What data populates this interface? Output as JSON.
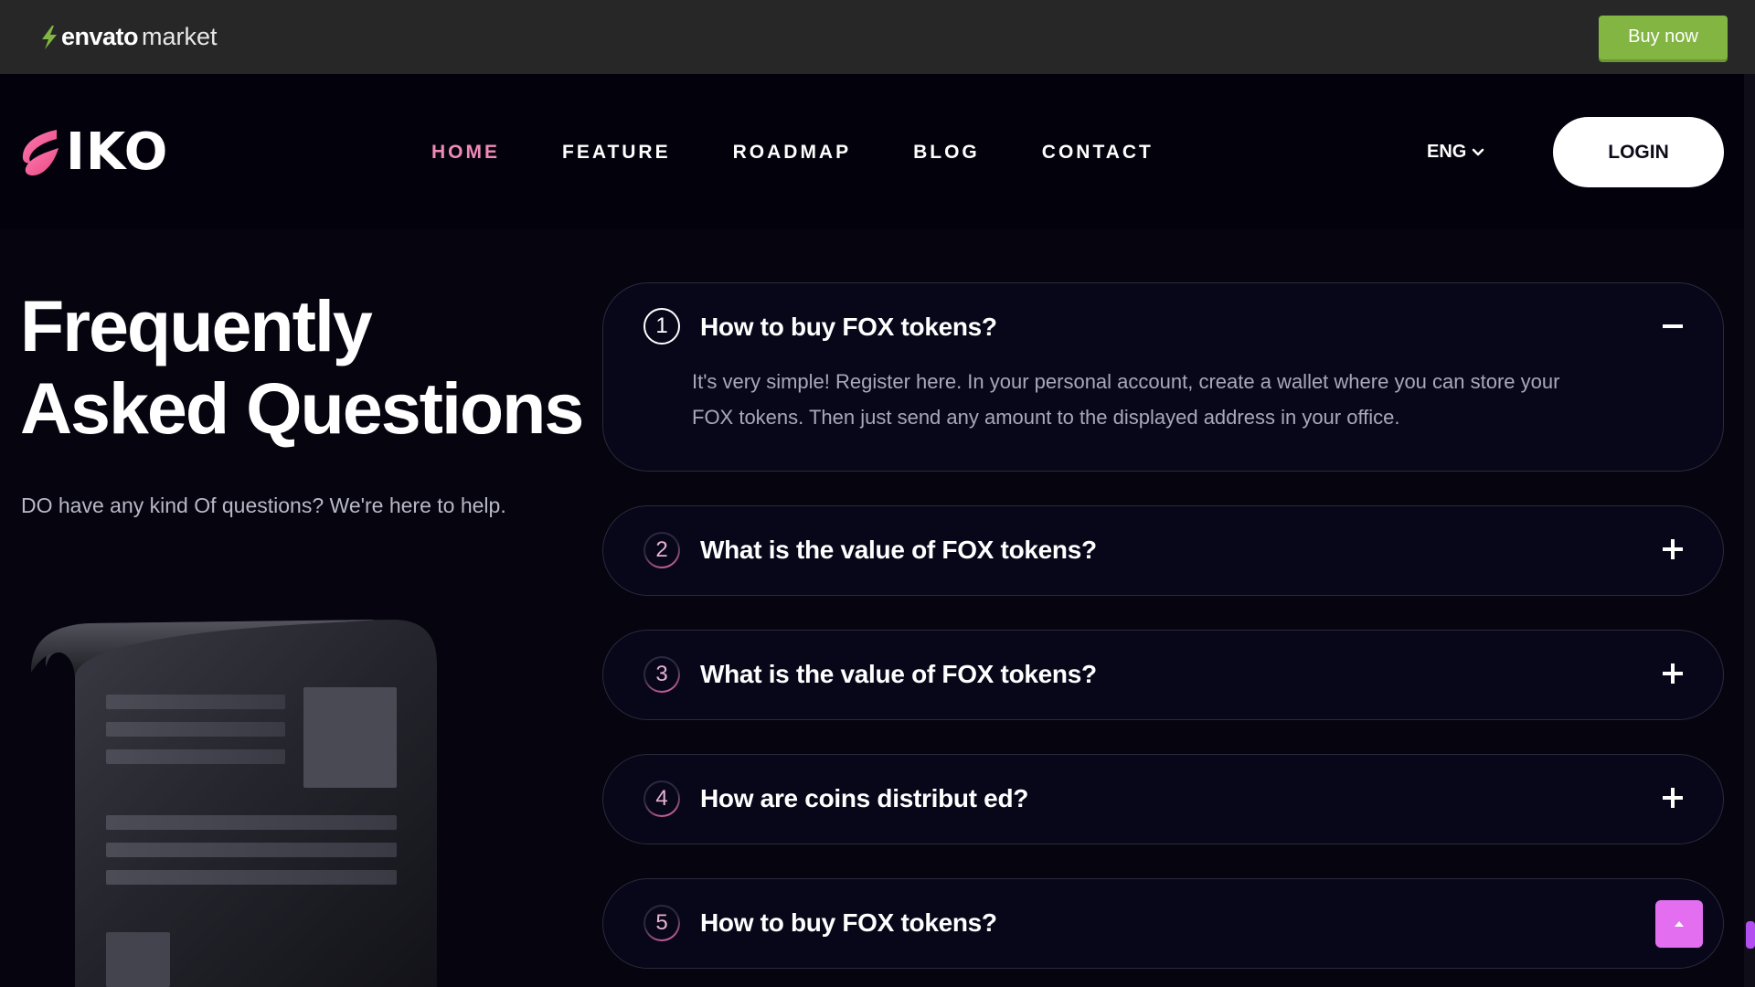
{
  "envato": {
    "brand": "envato",
    "market": "market",
    "buy_label": "Buy now",
    "accent": "#82b541"
  },
  "header": {
    "logo_text": "IKO",
    "nav": [
      {
        "label": "HOME",
        "active": true
      },
      {
        "label": "FEATURE",
        "active": false
      },
      {
        "label": "ROADMAP",
        "active": false
      },
      {
        "label": "BLOG",
        "active": false
      },
      {
        "label": "CONTACT",
        "active": false
      }
    ],
    "lang": "ENG",
    "login_label": "LOGIN",
    "accent": "#ef8bb6"
  },
  "hero": {
    "title_line1": "Frequently",
    "title_line2": "Asked Questions",
    "subtitle": "DO have any kind Of questions? We're here to help."
  },
  "faq": [
    {
      "num": "1",
      "question": "How to buy FOX tokens?",
      "answer_line1": "It's very simple! Register here. In your personal account, create a wallet where you can store your",
      "answer_line2": "FOX tokens. Then just send any amount to the displayed address in your office.",
      "expanded": true,
      "toggle_icon": "minus-icon"
    },
    {
      "num": "2",
      "question": "What is the value of FOX tokens?",
      "expanded": false,
      "toggle_icon": "plus-icon"
    },
    {
      "num": "3",
      "question": "What is the value of FOX tokens?",
      "expanded": false,
      "toggle_icon": "plus-icon"
    },
    {
      "num": "4",
      "question": "How are coins distribut ed?",
      "expanded": false,
      "toggle_icon": "plus-icon"
    },
    {
      "num": "5",
      "question": "How to buy FOX tokens?",
      "expanded": false,
      "toggle_icon": "plus-icon"
    }
  ],
  "back_to_top": {
    "icon": "chevron-up-icon",
    "color": "#e36ff0"
  }
}
